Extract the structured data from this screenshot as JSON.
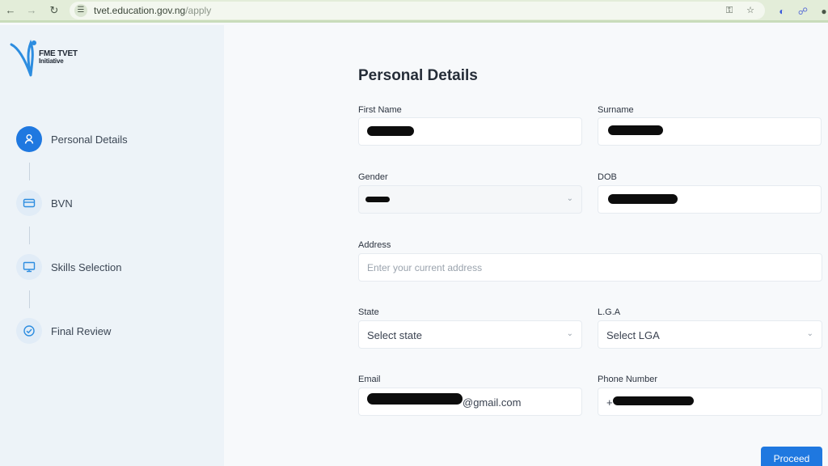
{
  "browser": {
    "url_host": "tvet.education.gov.ng",
    "url_path": "/apply"
  },
  "brand": {
    "logo_line1": "FME TVET",
    "logo_line2": "Initiative",
    "primary_color": "#1f78e0"
  },
  "steps": [
    {
      "label": "Personal Details",
      "icon": "user-icon",
      "active": true
    },
    {
      "label": "BVN",
      "icon": "card-icon",
      "active": false
    },
    {
      "label": "Skills Selection",
      "icon": "monitor-icon",
      "active": false
    },
    {
      "label": "Final Review",
      "icon": "check-circle-icon",
      "active": false
    }
  ],
  "form": {
    "title": "Personal Details",
    "first_name": {
      "label": "First Name"
    },
    "surname": {
      "label": "Surname"
    },
    "gender": {
      "label": "Gender"
    },
    "dob": {
      "label": "DOB"
    },
    "address": {
      "label": "Address",
      "placeholder": "Enter your current address"
    },
    "state": {
      "label": "State",
      "value": "Select state"
    },
    "lga": {
      "label": "L.G.A",
      "value": "Select LGA"
    },
    "email": {
      "label": "Email",
      "value_suffix": "@gmail.com"
    },
    "phone": {
      "label": "Phone Number",
      "value_prefix": "+"
    },
    "proceed_label": "Proceed"
  }
}
